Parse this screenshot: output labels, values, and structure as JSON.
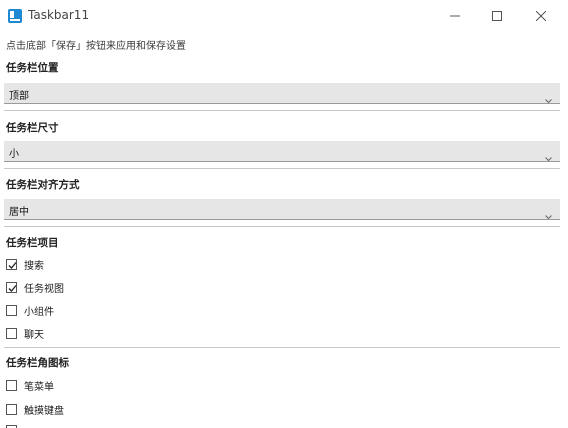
{
  "window": {
    "title": "Taskbar11",
    "icons": {
      "app": "taskbar11-app-icon",
      "minimize": "minimize-icon",
      "maximize": "maximize-icon",
      "close": "close-icon"
    }
  },
  "hint": "点击底部「保存」按钮来应用和保存设置",
  "sections": {
    "position": {
      "label": "任务栏位置",
      "value": "顶部"
    },
    "size": {
      "label": "任务栏尺寸",
      "value": "小"
    },
    "alignment": {
      "label": "任务栏对齐方式",
      "value": "居中"
    },
    "items": {
      "label": "任务栏项目",
      "options": [
        {
          "label": "搜索",
          "checked": true
        },
        {
          "label": "任务视图",
          "checked": true
        },
        {
          "label": "小组件",
          "checked": false
        },
        {
          "label": "聊天",
          "checked": false
        }
      ]
    },
    "corner_icons": {
      "label": "任务栏角图标",
      "options": [
        {
          "label": "笔菜单",
          "checked": false
        },
        {
          "label": "触摸键盘",
          "checked": false
        }
      ]
    }
  },
  "colors": {
    "select_bg": "#e6e6e6",
    "accent": "#1e88d2"
  }
}
